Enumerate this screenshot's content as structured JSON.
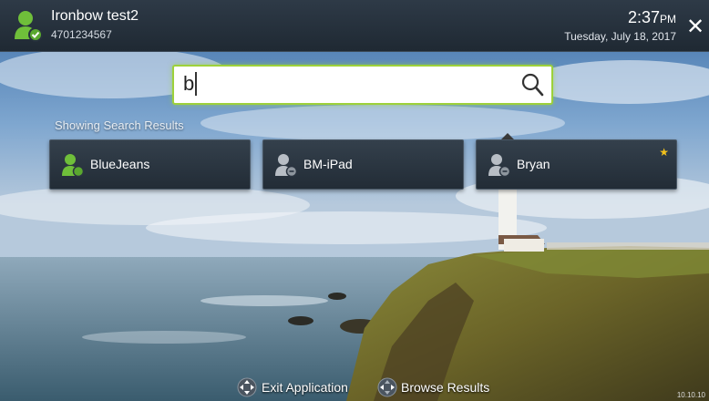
{
  "header": {
    "user_name": "Ironbow test2",
    "user_number": "4701234567",
    "time": "2:37",
    "ampm": "PM",
    "date": "Tuesday, July 18, 2017",
    "close_glyph": "✕"
  },
  "search": {
    "value": "b",
    "icon": "search-icon"
  },
  "results": {
    "label": "Showing Search Results",
    "items": [
      {
        "name": "BlueJeans",
        "status": "available",
        "status_color": "#6fbf3a",
        "favorite": false
      },
      {
        "name": "BM-iPad",
        "status": "offline",
        "status_color": "#9aa3ac",
        "favorite": false
      },
      {
        "name": "Bryan",
        "status": "offline",
        "status_color": "#9aa3ac",
        "favorite": true,
        "star": "★"
      }
    ]
  },
  "footer": {
    "exit_label": "Exit Application",
    "browse_label": "Browse Results",
    "version": "10.10.10"
  },
  "colors": {
    "accent_green": "#9dd13a",
    "star": "#f3c21c",
    "bar": "#26313c"
  }
}
